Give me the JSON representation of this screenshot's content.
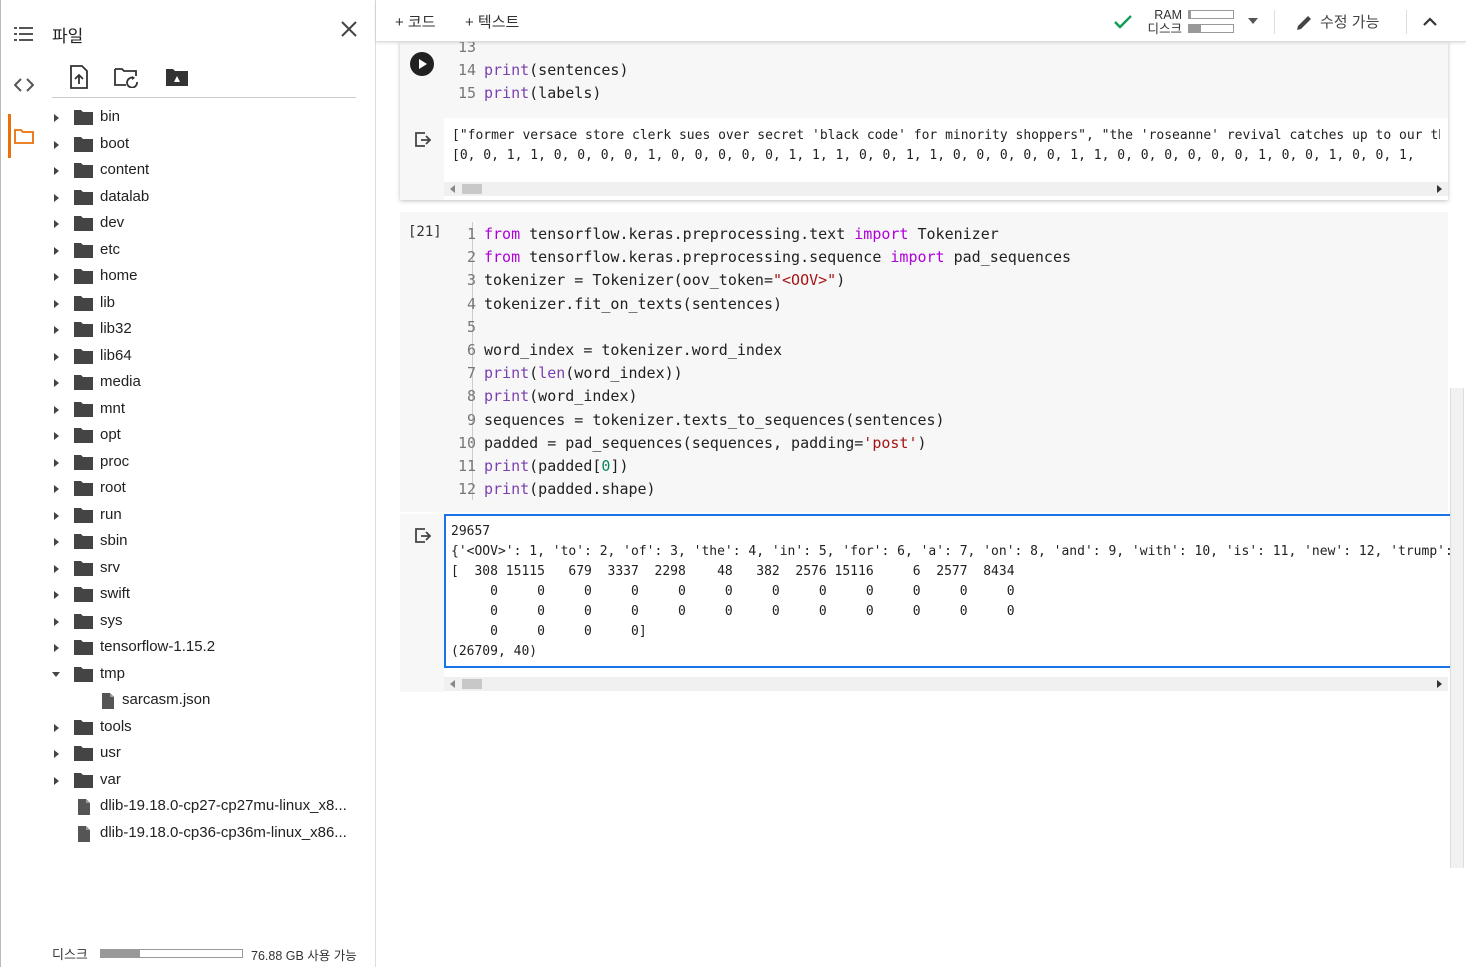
{
  "sidebar": {
    "title": "파일",
    "tree": [
      {
        "name": "bin",
        "type": "folder",
        "expanded": false
      },
      {
        "name": "boot",
        "type": "folder",
        "expanded": false
      },
      {
        "name": "content",
        "type": "folder",
        "expanded": false
      },
      {
        "name": "datalab",
        "type": "folder",
        "expanded": false
      },
      {
        "name": "dev",
        "type": "folder",
        "expanded": false
      },
      {
        "name": "etc",
        "type": "folder",
        "expanded": false
      },
      {
        "name": "home",
        "type": "folder",
        "expanded": false
      },
      {
        "name": "lib",
        "type": "folder",
        "expanded": false
      },
      {
        "name": "lib32",
        "type": "folder",
        "expanded": false
      },
      {
        "name": "lib64",
        "type": "folder",
        "expanded": false
      },
      {
        "name": "media",
        "type": "folder",
        "expanded": false
      },
      {
        "name": "mnt",
        "type": "folder",
        "expanded": false
      },
      {
        "name": "opt",
        "type": "folder",
        "expanded": false
      },
      {
        "name": "proc",
        "type": "folder",
        "expanded": false
      },
      {
        "name": "root",
        "type": "folder",
        "expanded": false
      },
      {
        "name": "run",
        "type": "folder",
        "expanded": false
      },
      {
        "name": "sbin",
        "type": "folder",
        "expanded": false
      },
      {
        "name": "srv",
        "type": "folder",
        "expanded": false
      },
      {
        "name": "swift",
        "type": "folder",
        "expanded": false
      },
      {
        "name": "sys",
        "type": "folder",
        "expanded": false
      },
      {
        "name": "tensorflow-1.15.2",
        "type": "folder",
        "expanded": false
      },
      {
        "name": "tmp",
        "type": "folder",
        "expanded": true
      },
      {
        "name": "sarcasm.json",
        "type": "file",
        "child": true
      },
      {
        "name": "tools",
        "type": "folder",
        "expanded": false
      },
      {
        "name": "usr",
        "type": "folder",
        "expanded": false
      },
      {
        "name": "var",
        "type": "folder",
        "expanded": false
      },
      {
        "name": "dlib-19.18.0-cp27-cp27mu-linux_x8...",
        "type": "file"
      },
      {
        "name": "dlib-19.18.0-cp36-cp36m-linux_x86...",
        "type": "file"
      }
    ],
    "disk_label": "디스크",
    "disk_text": "76.88 GB 사용 가능",
    "disk_used_fraction": 0.28
  },
  "toolbar": {
    "add_code": "+ 코드",
    "add_text": "+ 텍스트",
    "ram_label": "RAM",
    "disk_label": "디스크",
    "ram_fraction": 0.05,
    "disk_fraction": 0.27,
    "edit_label": "수정 가능",
    "status_color": "#0f9d58"
  },
  "cell1": {
    "lines": [
      {
        "n": "13",
        "html": ""
      },
      {
        "n": "14",
        "html": "<span class=\"pfn\">print</span>(sentences)"
      },
      {
        "n": "15",
        "html": "<span class=\"pfn\">print</span>(labels)"
      }
    ],
    "output": [
      "[\"former versace store clerk sues over secret 'black code' for minority shoppers\", \"the 'roseanne' revival catches up to our thor",
      "[0, 0, 1, 1, 0, 0, 0, 0, 1, 0, 0, 0, 0, 0, 1, 1, 1, 0, 0, 1, 1, 0, 0, 0, 0, 0, 1, 1, 0, 0, 0, 0, 0, 0, 1, 0, 0, 1, 0, 0, 1,"
    ]
  },
  "cell2": {
    "exec_count": "[21]",
    "lines": [
      {
        "n": "1",
        "html": "<span class=\"kw\">from</span> tensorflow.keras.preprocessing.text <span class=\"kw\">import</span> Tokenizer"
      },
      {
        "n": "2",
        "html": "<span class=\"kw\">from</span> tensorflow.keras.preprocessing.sequence <span class=\"kw\">import</span> pad_sequences"
      },
      {
        "n": "3",
        "html": "tokenizer = Tokenizer(oov_token=<span class=\"str\">\"&lt;OOV&gt;\"</span>)"
      },
      {
        "n": "4",
        "html": "tokenizer.fit_on_texts(sentences)"
      },
      {
        "n": "5",
        "html": ""
      },
      {
        "n": "6",
        "html": "word_index = tokenizer.word_index"
      },
      {
        "n": "7",
        "html": "<span class=\"pfn\">print</span>(<span class=\"pfn\">len</span>(word_index))"
      },
      {
        "n": "8",
        "html": "<span class=\"pfn\">print</span>(word_index)"
      },
      {
        "n": "9",
        "html": "sequences = tokenizer.texts_to_sequences(sentences)"
      },
      {
        "n": "10",
        "html": "padded = pad_sequences(sequences, padding=<span class=\"str\">'post'</span>)"
      },
      {
        "n": "11",
        "html": "<span class=\"pfn\">print</span>(padded[<span class=\"num\">0</span>])"
      },
      {
        "n": "12",
        "html": "<span class=\"pfn\">print</span>(padded.shape)"
      }
    ],
    "output": [
      "29657",
      "{'<OOV>': 1, 'to': 2, 'of': 3, 'the': 4, 'in': 5, 'for': 6, 'a': 7, 'on': 8, 'and': 9, 'with': 10, 'is': 11, 'new': 12, 'trump':",
      "[  308 15115   679  3337  2298    48   382  2576 15116     6  2577  8434",
      "     0     0     0     0     0     0     0     0     0     0     0     0",
      "     0     0     0     0     0     0     0     0     0     0     0     0",
      "     0     0     0     0]",
      "(26709, 40)"
    ]
  }
}
